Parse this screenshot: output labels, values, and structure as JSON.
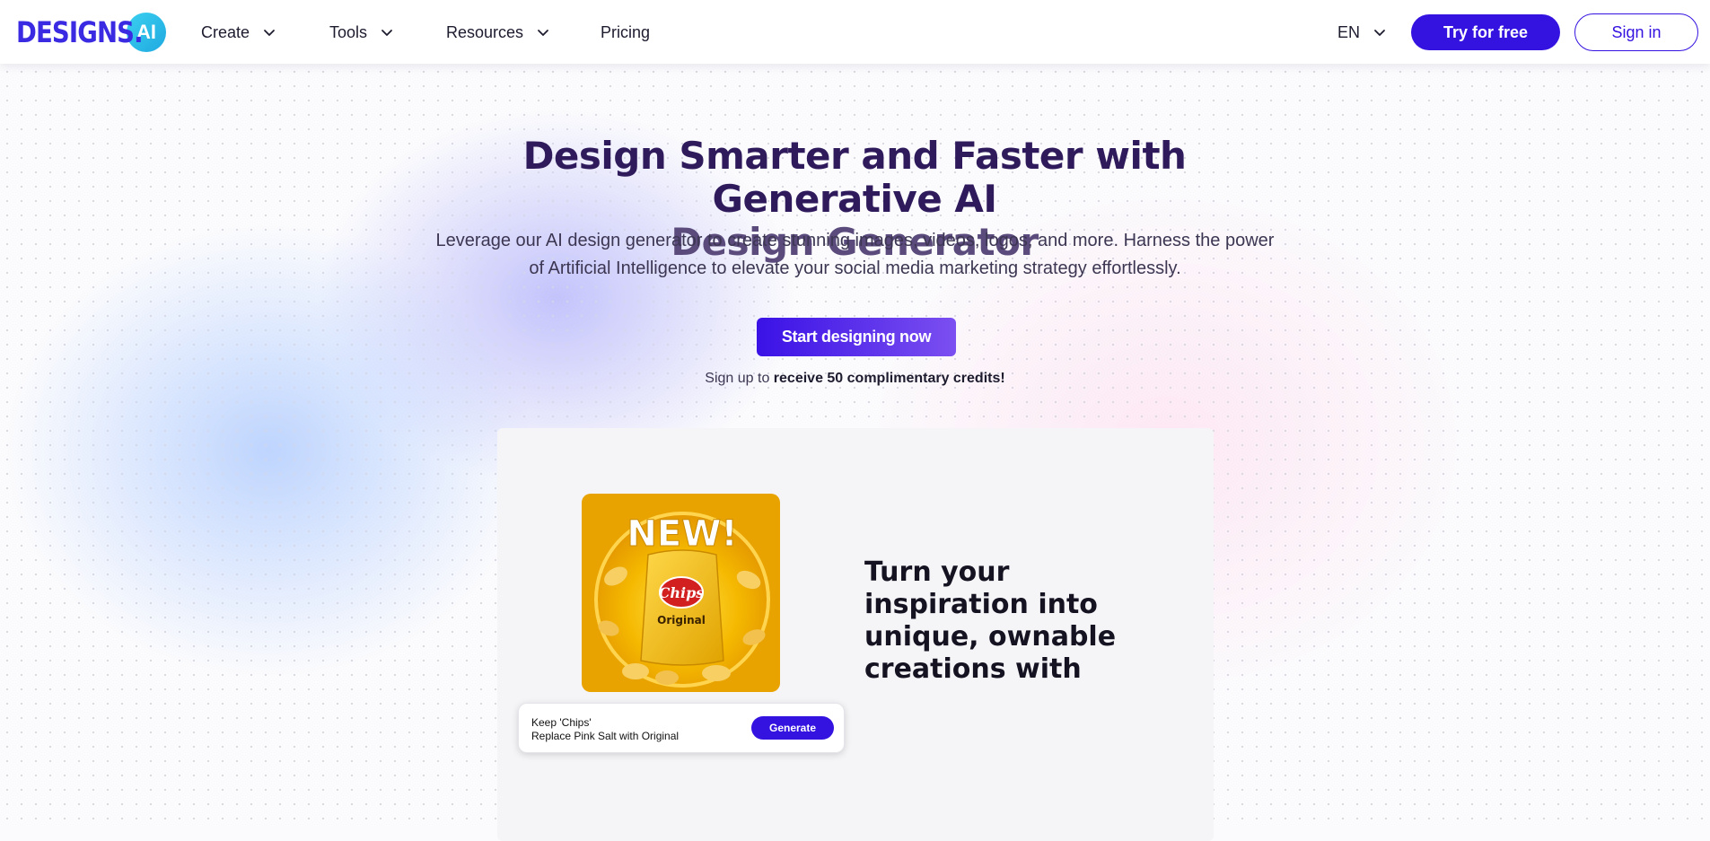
{
  "brand": {
    "logo_text": "DESIGNS.",
    "logo_badge": "AI",
    "accent": "#3412e0",
    "logo_color": "#3a2be3"
  },
  "nav": {
    "items": [
      {
        "label": "Create",
        "dropdown": true
      },
      {
        "label": "Tools",
        "dropdown": true
      },
      {
        "label": "Resources",
        "dropdown": true
      },
      {
        "label": "Pricing",
        "dropdown": false
      }
    ],
    "language": "EN",
    "try_label": "Try for free",
    "signin_label": "Sign in"
  },
  "hero": {
    "title_line1": "Design Smarter and Faster with Generative AI",
    "title_line2": "Design Generator",
    "subtitle_line1": "Leverage our AI design generator to create stunning images, videos, logos, and more. Harness the power",
    "subtitle_line2": "of Artificial Intelligence to elevate your social media marketing strategy effortlessly.",
    "cta_label": "Start designing now",
    "signup_prefix": "Sign up to ",
    "signup_bold": "receive 50 complimentary credits!"
  },
  "demo": {
    "image_badge": "NEW!",
    "image_brand": "Chips",
    "image_flavor": "Original",
    "prompt_line1": "Keep 'Chips'",
    "prompt_line2": "Replace Pink Salt with Original",
    "generate_label": "Generate",
    "tagline": "Turn your inspiration into unique, ownable creations with"
  },
  "icons": {
    "nav_dropdown": "chevron-down-icon",
    "language_dropdown": "chevron-down-icon"
  }
}
